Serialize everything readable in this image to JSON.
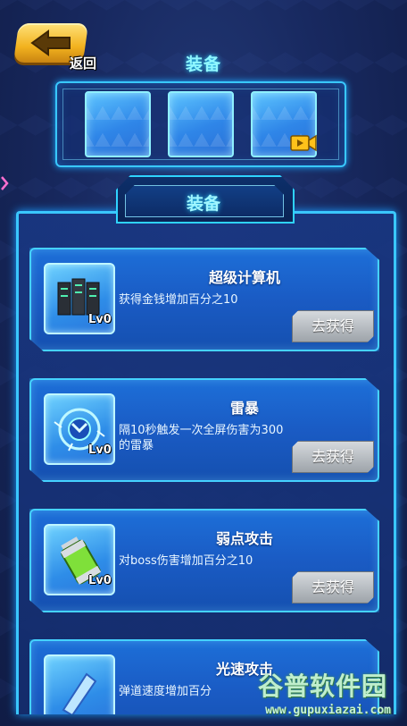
{
  "header": {
    "back_label": "返回",
    "title": "装备"
  },
  "equip_slots": [
    {
      "state": "empty",
      "icon": "none"
    },
    {
      "state": "empty",
      "icon": "none"
    },
    {
      "state": "empty",
      "icon": "video-ad-icon"
    }
  ],
  "list": {
    "tab_label": "装备",
    "items": [
      {
        "name": "超级计算机",
        "level": "Lv0",
        "description": "获得金钱增加百分之10",
        "button": "去获得",
        "icon": "server-rack-icon"
      },
      {
        "name": "雷暴",
        "level": "Lv0",
        "description": "隔10秒触发一次全屏伤害为300的雷暴",
        "button": "去获得",
        "icon": "lightning-orb-icon"
      },
      {
        "name": "弱点攻击",
        "level": "Lv0",
        "description": "对boss伤害增加百分之10",
        "button": "去获得",
        "icon": "green-battery-icon"
      },
      {
        "name": "光速攻击",
        "level": "",
        "description": "弹道速度增加百分",
        "button": "",
        "icon": "blue-blade-icon"
      }
    ]
  },
  "watermark": {
    "brand": "谷普软件园",
    "url": "www.gupuxiazai.com"
  },
  "colors": {
    "accent_cyan": "#3ac7ff",
    "button_gold": "#f2b21f",
    "card_blue": "#1a5bc4",
    "button_grey": "#a8aeb4"
  }
}
